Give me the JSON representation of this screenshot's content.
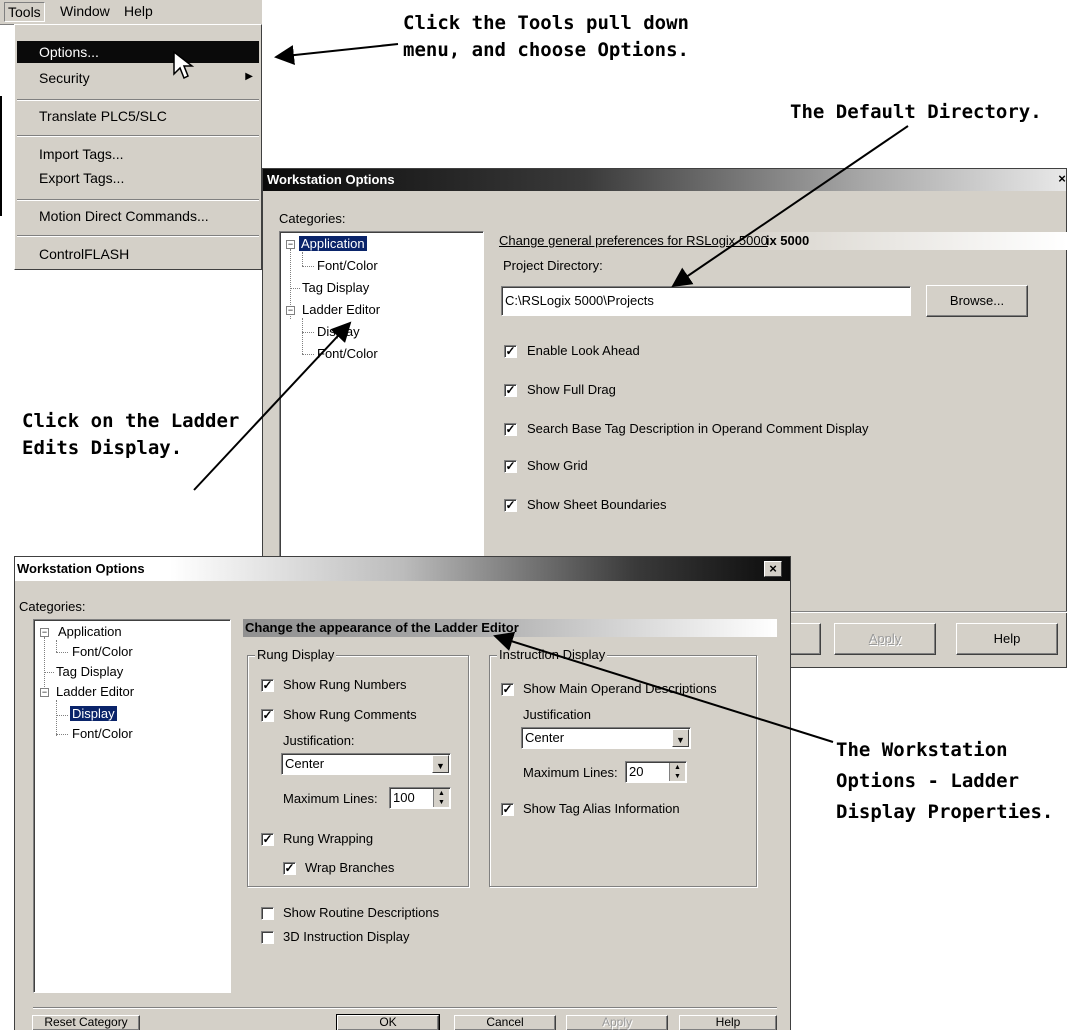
{
  "menubar": {
    "items": [
      "Tools",
      "Window",
      "Help"
    ]
  },
  "tools_menu": {
    "items": [
      "Options...",
      "Security",
      "Translate PLC5/SLC",
      "Import Tags...",
      "Export Tags...",
      "Motion Direct Commands...",
      "ControlFLASH"
    ],
    "security_arrow": "▶"
  },
  "annotations": {
    "tools_menu_l1": "Click the Tools pull down",
    "tools_menu_l2": "menu, and choose Options.",
    "default_dir": "The Default Directory.",
    "ladder_l1": "Click on the Ladder",
    "ladder_l2": "Edits Display.",
    "ws_l1": "The Workstation",
    "ws_l2": "Options - Ladder",
    "ws_l3": "Display Properties."
  },
  "back_dialog": {
    "title": "Workstation Options",
    "close": "×",
    "categories_label": "Categories:",
    "tree": [
      "Application",
      "Font/Color",
      "Tag Display",
      "Ladder Editor",
      "Display",
      "Font/Color"
    ],
    "header": "Change general preferences for RSLogix 5000",
    "header_overlap": "ix 5000",
    "project_dir_label": "Project Directory:",
    "project_dir_value": "C:\\RSLogix 5000\\Projects",
    "browse": "Browse...",
    "checks": [
      "Enable Look Ahead",
      "Show Full Drag",
      "Search Base Tag Description in Operand Comment Display",
      "Show Grid",
      "Show Sheet Boundaries"
    ],
    "buttons": {
      "apply": "Apply",
      "help": "Help"
    }
  },
  "front_dialog": {
    "title": "Workstation Options",
    "close": "×",
    "categories_label": "Categories:",
    "tree": [
      "Application",
      "Font/Color",
      "Tag Display",
      "Ladder Editor",
      "Display",
      "Font/Color"
    ],
    "header": "Change the appearance of the Ladder Editor",
    "rung_group": "Rung Display",
    "show_rung_numbers": "Show Rung Numbers",
    "show_rung_comments": "Show Rung Comments",
    "justification_label": "Justification:",
    "rung_justification": "Center",
    "max_lines_label": "Maximum Lines:",
    "rung_max_lines": "100",
    "rung_wrapping": "Rung Wrapping",
    "wrap_branches": "Wrap Branches",
    "instr_group": "Instruction Display",
    "show_main_operand": "Show Main Operand Descriptions",
    "instr_justification_label": "Justification",
    "instr_justification": "Center",
    "instr_max_lines_label": "Maximum Lines:",
    "instr_max_lines": "20",
    "show_tag_alias": "Show Tag Alias Information",
    "show_routine_desc": "Show Routine Descriptions",
    "instr_3d": "3D Instruction Display",
    "buttons": {
      "reset": "Reset Category",
      "ok": "OK",
      "cancel": "Cancel",
      "apply": "Apply",
      "help": "Help"
    }
  },
  "check_glyph": "✓"
}
